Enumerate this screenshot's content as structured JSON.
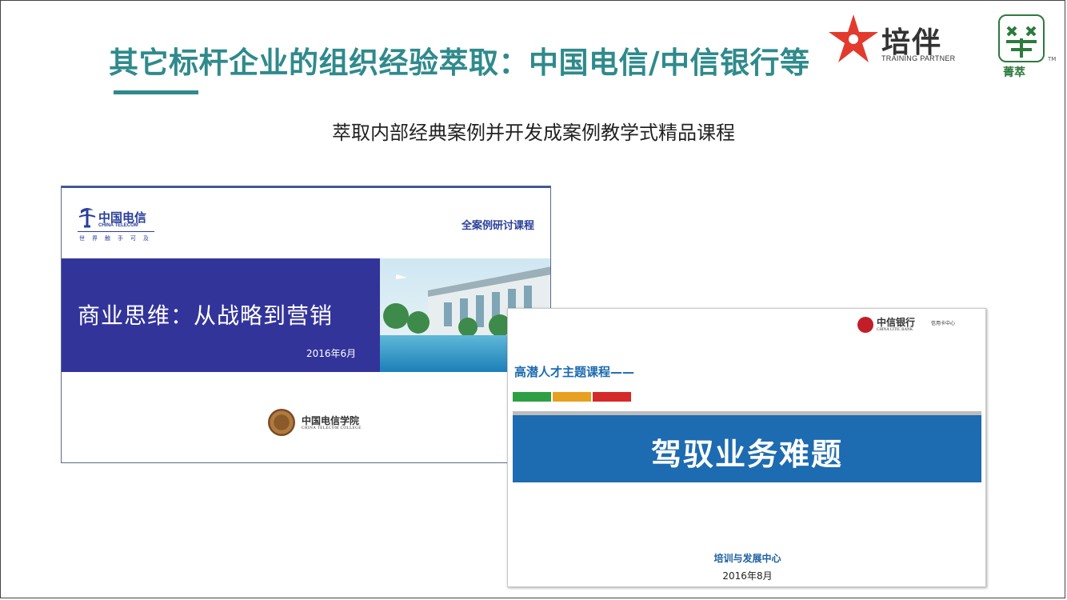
{
  "header": {
    "title": "其它标杆企业的组织经验萃取：中国电信/中信银行等",
    "subtitle": "萃取内部经典案例并开发成案例教学式精品课程"
  },
  "logos": {
    "peiban": {
      "name": "培伴",
      "sub": "TRAINING PARTNER",
      "icon": "red-star-icon"
    },
    "jingcui": {
      "name": "菁萃",
      "tm": "TM",
      "icon": "jingcui-mark-icon"
    }
  },
  "slide1": {
    "brand_name": "中国电信",
    "brand_en": "CHINA TELECOM",
    "brand_slogan": "世界触手可及",
    "course_type": "全案例研讨课程",
    "title": "商业思维：从战略到营销",
    "date": "2016年6月",
    "college_name": "中国电信学院",
    "college_en": "CHINA TELECOM COLLEGE"
  },
  "slide2": {
    "brand_name": "中信银行",
    "brand_en": "CHINA CITIC BANK",
    "brand_unit": "信用卡中心",
    "series": "高潜人才主题课程——",
    "title": "驾驭业务难题",
    "center": "培训与发展中心",
    "date": "2016年8月",
    "bar_colors": [
      "#2ea043",
      "#e8a020",
      "#d42a2a"
    ]
  },
  "colors": {
    "title_teal": "#2f8a8c",
    "telecom_blue": "#33349a",
    "citic_blue": "#1d6bb0"
  }
}
